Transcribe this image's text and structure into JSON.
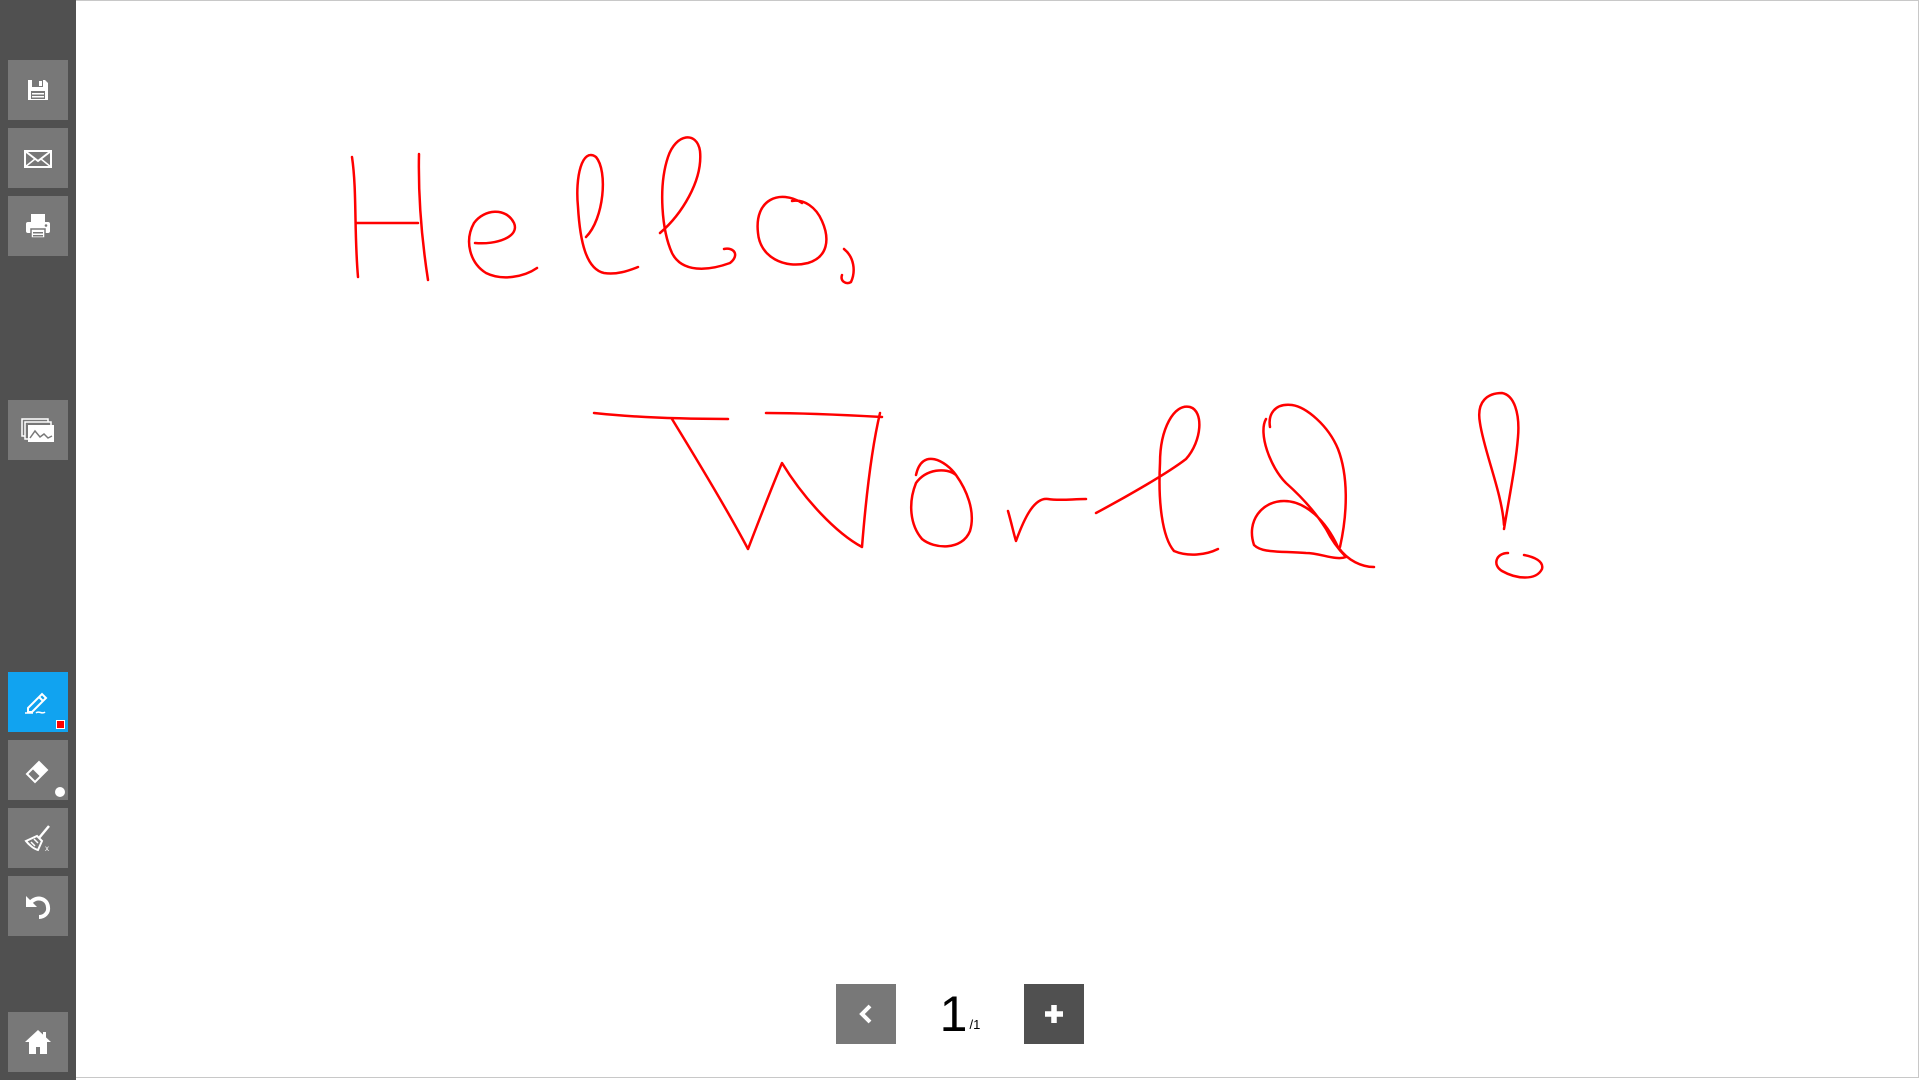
{
  "sidebar": {
    "top_tools": [
      {
        "name": "save-button",
        "icon": "floppy-disk-icon"
      },
      {
        "name": "email-button",
        "icon": "envelope-icon"
      },
      {
        "name": "print-button",
        "icon": "printer-icon"
      },
      {
        "name": "background-button",
        "icon": "image-stack-icon"
      }
    ],
    "bottom_tools": [
      {
        "name": "pen-button",
        "icon": "pen-icon",
        "active": true,
        "indicator_color": "#ff0000"
      },
      {
        "name": "eraser-button",
        "icon": "eraser-icon",
        "indicator_color": "#ffffff"
      },
      {
        "name": "clear-button",
        "icon": "broom-icon"
      },
      {
        "name": "undo-button",
        "icon": "undo-icon"
      },
      {
        "name": "home-button",
        "icon": "home-icon"
      }
    ]
  },
  "canvas": {
    "handwriting": "Hello, World!",
    "ink_color": "#ff0000"
  },
  "pager": {
    "current_page": "1",
    "total_pages": "/1",
    "prev_icon": "chevron-left-icon",
    "add_icon": "plus-icon"
  },
  "colors": {
    "sidebar_bg": "#505050",
    "tool_bg": "#787878",
    "active_tool_bg": "#11a3f0",
    "ink": "#ff0000"
  }
}
